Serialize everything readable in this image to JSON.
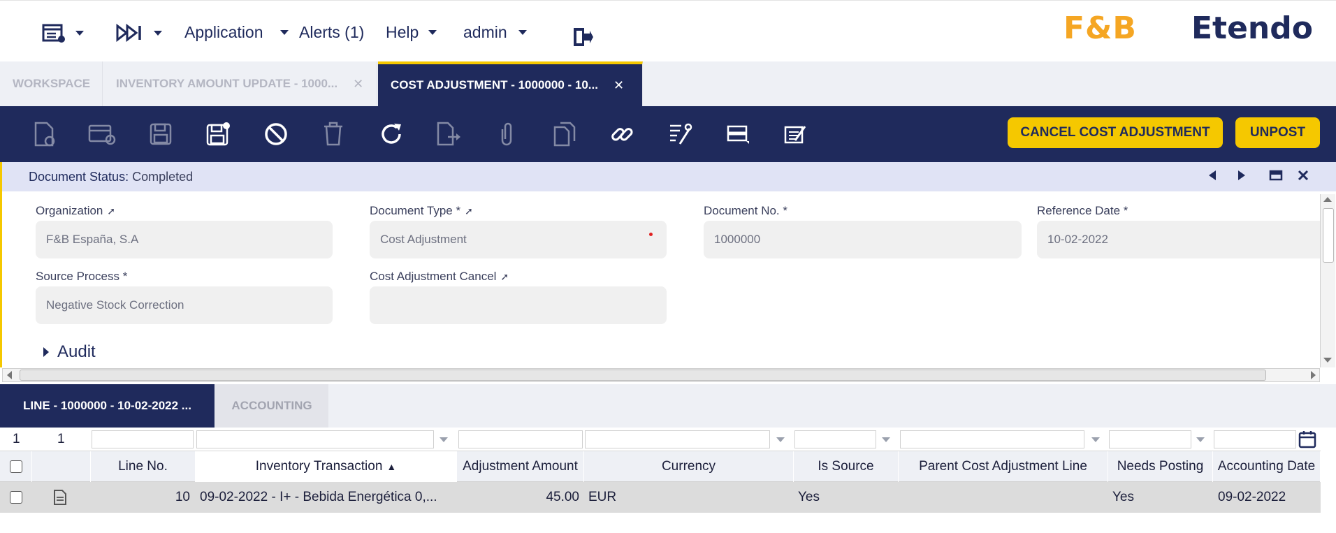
{
  "topbar": {
    "menu_application": "Application",
    "menu_alerts": "Alerts (1)",
    "menu_help": "Help",
    "menu_user": "admin",
    "logo_fb": "F&B",
    "logo_brand": "Etendo"
  },
  "tabs": [
    {
      "label": "WORKSPACE"
    },
    {
      "label": "INVENTORY AMOUNT UPDATE - 1000..."
    },
    {
      "label": "COST ADJUSTMENT - 1000000 - 10..."
    }
  ],
  "toolbar": {
    "cancel_label": "CANCEL COST ADJUSTMENT",
    "unpost_label": "UNPOST"
  },
  "status": {
    "label": "Document Status:",
    "value": "Completed"
  },
  "form": {
    "organization_label": "Organization",
    "organization_value": "F&B España, S.A",
    "doctype_label": "Document Type *",
    "doctype_value": "Cost Adjustment",
    "docno_label": "Document No. *",
    "docno_value": "1000000",
    "refdate_label": "Reference Date *",
    "refdate_value": "10-02-2022",
    "source_label": "Source Process *",
    "source_value": "Negative Stock Correction",
    "cancel_label": "Cost Adjustment Cancel",
    "cancel_value": "",
    "audit_label": "Audit"
  },
  "subtabs": [
    {
      "label": "LINE - 1000000 - 10-02-2022 ..."
    },
    {
      "label": "ACCOUNTING"
    }
  ],
  "grid": {
    "count_a": "1",
    "count_b": "1",
    "columns": [
      "Line No.",
      "Inventory Transaction",
      "Adjustment Amount",
      "Currency",
      "Is Source",
      "Parent Cost Adjustment Line",
      "Needs Posting",
      "Accounting Date"
    ],
    "rows": [
      {
        "line_no": "10",
        "inventory_transaction": "09-02-2022 - I+ - Bebida Energética 0,...",
        "adjustment_amount": "45.00",
        "currency": "EUR",
        "is_source": "Yes",
        "parent_line": "",
        "needs_posting": "Yes",
        "accounting_date": "09-02-2022"
      }
    ]
  },
  "colors": {
    "navy": "#1f2a5c",
    "accent_yellow": "#f5c800",
    "fb_orange": "#f5a623"
  }
}
